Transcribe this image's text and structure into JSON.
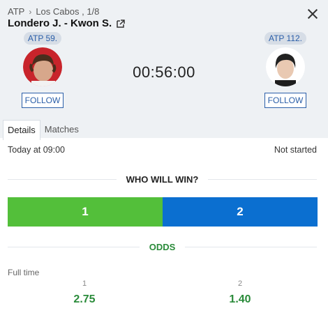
{
  "header": {
    "breadcrumb": {
      "sport": "ATP",
      "tournament": "Los Cabos , 1/8"
    },
    "match_title": "Londero J. - Kwon S."
  },
  "players": {
    "home": {
      "rank": "ATP 59.",
      "follow_label": "FOLLOW"
    },
    "away": {
      "rank": "ATP 112.",
      "follow_label": "FOLLOW"
    }
  },
  "timer": "00:56:00",
  "tabs": [
    {
      "label": "Details",
      "active": true
    },
    {
      "label": "Matches",
      "active": false
    }
  ],
  "info": {
    "start": "Today at 09:00",
    "status": "Not started"
  },
  "poll": {
    "heading": "WHO WILL WIN?",
    "option1": "1",
    "option2": "2",
    "option1_color": "#53bf3a",
    "option2_color": "#0b6fd0"
  },
  "odds": {
    "heading": "ODDS",
    "period": "Full time",
    "col1": {
      "label": "1",
      "value": "2.75"
    },
    "col2": {
      "label": "2",
      "value": "1.40"
    }
  }
}
